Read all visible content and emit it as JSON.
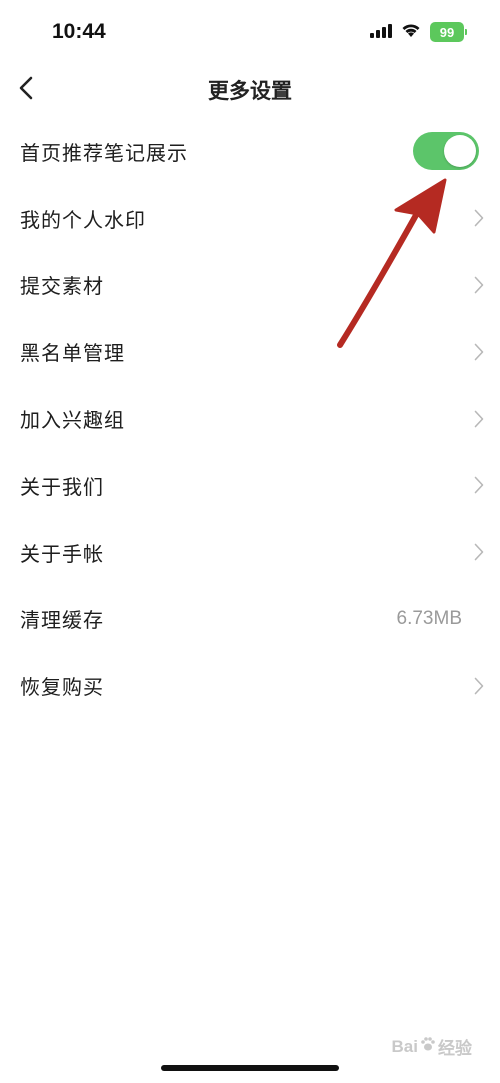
{
  "status_bar": {
    "time": "10:44",
    "battery": "99",
    "icons": [
      "signal-icon",
      "wifi-icon",
      "battery-icon"
    ]
  },
  "nav": {
    "title": "更多设置",
    "back_icon": "chevron-left-icon"
  },
  "settings": {
    "homepage_notes": {
      "label": "首页推荐笔记展示",
      "enabled": true
    },
    "watermark": {
      "label": "我的个人水印"
    },
    "submit_material": {
      "label": "提交素材"
    },
    "blacklist": {
      "label": "黑名单管理"
    },
    "interest_group": {
      "label": "加入兴趣组"
    },
    "about_us": {
      "label": "关于我们"
    },
    "about_journal": {
      "label": "关于手帐"
    },
    "clear_cache": {
      "label": "清理缓存",
      "value": "6.73MB"
    },
    "restore_purchase": {
      "label": "恢复购买"
    }
  },
  "watermark_brand": {
    "text": "Bai",
    "suffix": "经验"
  },
  "colors": {
    "toggle_on": "#5cc56a",
    "battery": "#5cc85c",
    "annotation_arrow": "#b52a22",
    "secondary_text": "#9a9a9a"
  }
}
